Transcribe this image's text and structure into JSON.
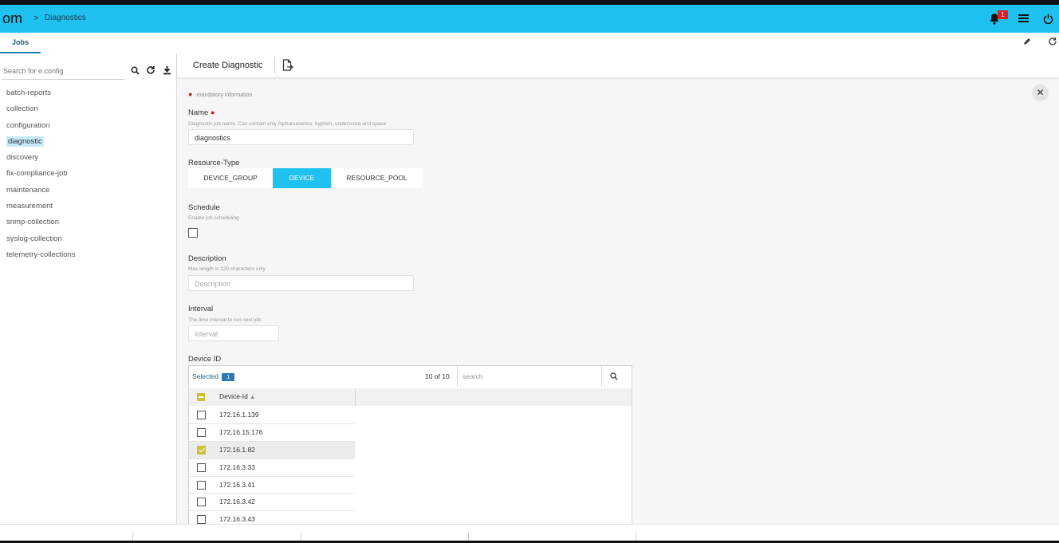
{
  "header": {
    "brand": "om",
    "crumb_separator": ">",
    "breadcrumb": "Diagnostics",
    "notification_count": "1",
    "colors": {
      "header_bg": "#1fc1f0",
      "badge": "#e02020"
    }
  },
  "tabs": [
    {
      "label": "Jobs",
      "active": true
    }
  ],
  "sidebar": {
    "search_placeholder": "Search for e.config",
    "items": [
      {
        "label": "batch-reports"
      },
      {
        "label": "collection"
      },
      {
        "label": "configuration"
      },
      {
        "label": "diagnostic",
        "active": true
      },
      {
        "label": "discovery"
      },
      {
        "label": "fix-compliance-job"
      },
      {
        "label": "maintenance"
      },
      {
        "label": "measurement"
      },
      {
        "label": "snmp-collection"
      },
      {
        "label": "syslog-collection"
      },
      {
        "label": "telemetry-collections"
      }
    ]
  },
  "toolbar": {
    "title": "Create Diagnostic"
  },
  "form": {
    "mandatory_note": "-mandatory information",
    "name": {
      "label": "Name",
      "hint": "Diagnostic job name. Can contain only Alphanumerics, hyphen, underscore and space",
      "value": "diagnostics"
    },
    "resource_type": {
      "label": "Resource-Type",
      "options": [
        "DEVICE_GROUP",
        "DEVICE",
        "RESOURCE_POOL"
      ],
      "selected": "DEVICE"
    },
    "schedule": {
      "label": "Schedule",
      "hint": "Enable job scheduling",
      "checked": false
    },
    "description": {
      "label": "Description",
      "hint": "Max length is 120 characters only",
      "placeholder": "Description"
    },
    "interval": {
      "label": "Interval",
      "hint": "The time interval to run next job",
      "placeholder": "interval"
    },
    "device_id": {
      "label": "Device ID",
      "selected_label": "Selected",
      "selected_count": "1",
      "range": "10 of 10",
      "search_placeholder": "search",
      "column_header": "Device-Id",
      "rows": [
        {
          "ip": "172.16.1.139",
          "checked": false
        },
        {
          "ip": "172.16.15.176",
          "checked": false
        },
        {
          "ip": "172.16.1.82",
          "checked": true
        },
        {
          "ip": "172.16.3.33",
          "checked": false
        },
        {
          "ip": "172.16.3.41",
          "checked": false
        },
        {
          "ip": "172.16.3.42",
          "checked": false
        },
        {
          "ip": "172.16.3.43",
          "checked": false
        }
      ]
    }
  },
  "icons": {
    "header": [
      "bell-icon",
      "menu-icon",
      "power-icon"
    ],
    "tabbar": [
      "edit-icon",
      "refresh-icon"
    ],
    "sidebar": [
      "search-icon",
      "refresh-icon",
      "download-icon"
    ],
    "toolbar": [
      "export-file-icon"
    ]
  }
}
